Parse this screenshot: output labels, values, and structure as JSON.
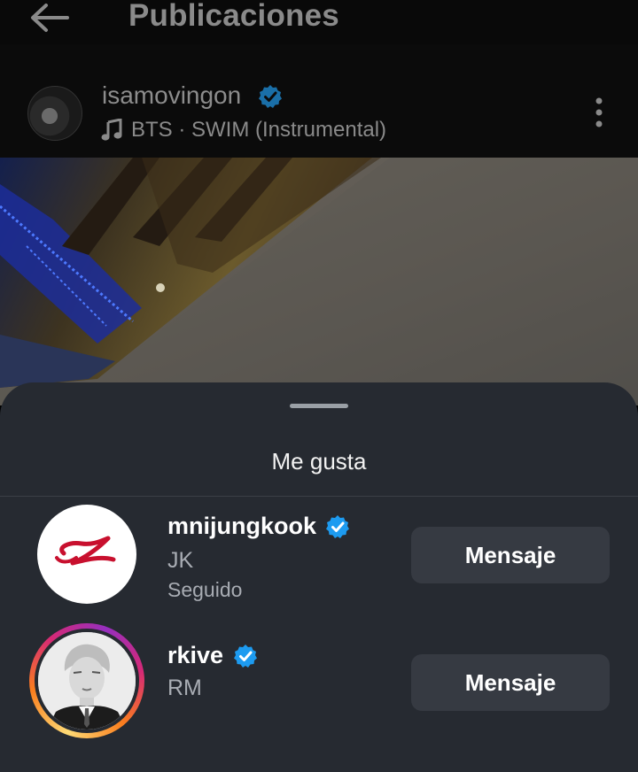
{
  "header": {
    "title": "Publicaciones"
  },
  "post": {
    "author": "isamovingon",
    "music": "BTS · SWIM (Instrumental)"
  },
  "sheet": {
    "title": "Me gusta",
    "users": [
      {
        "username": "mnijungkook",
        "full_name": "JK",
        "status": "Seguido",
        "button": "Mensaje"
      },
      {
        "username": "rkive",
        "full_name": "RM",
        "button": "Mensaje"
      }
    ]
  },
  "colors": {
    "verified": "#1d9bf0",
    "sheet_bg": "#262a31",
    "button_bg": "#363a42"
  },
  "icons": [
    "back-arrow-icon",
    "verified-icon",
    "music-note-icon",
    "more-vertical-icon"
  ]
}
